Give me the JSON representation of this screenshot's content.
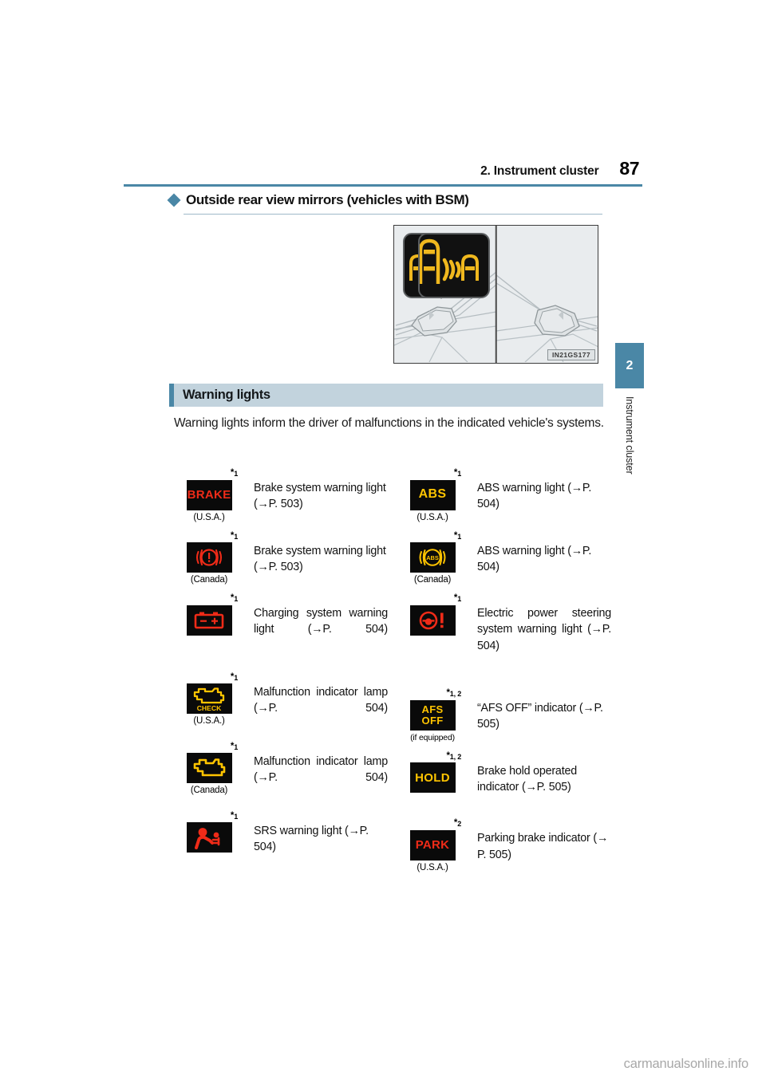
{
  "header": {
    "title": "2. Instrument cluster",
    "page_number": "87",
    "rule_color": "#4a87a6"
  },
  "sub_heading": {
    "bullet_icon": "diamond-bullet-icon",
    "text": "Outside rear view mirrors (vehicles with BSM)"
  },
  "figure": {
    "code": "IN21GS177",
    "alt": "Outside rear view mirrors with BSM indicator close-ups"
  },
  "section": {
    "title": "Warning lights",
    "accent_color": "#4a87a6",
    "band_color": "#c2d3dd",
    "intro": "Warning lights inform the driver of malfunctions in the indicated vehicle's systems."
  },
  "side_tab": {
    "number": "2",
    "label": "Instrument cluster",
    "color": "#4a87a6"
  },
  "watermark": "carmanualsonline.info",
  "colors": {
    "red": "#ef2b18",
    "amber": "#ffc400",
    "symbol_background": "#0a0a0a"
  },
  "warning_lights": {
    "left_column": [
      {
        "footnote": "*1",
        "symbol_type": "brake-text",
        "symbol_text": "BRAKE",
        "symbol_color": "#ef2b18",
        "note": "(U.S.A.)",
        "description": "Brake system warning light (→P. 503)"
      },
      {
        "footnote": "*1",
        "symbol_type": "brake-circle",
        "symbol_text": "(!)",
        "symbol_color": "#ef2b18",
        "note": "(Canada)",
        "description": "Brake system warning light (→P. 503)"
      },
      {
        "footnote": "*1",
        "symbol_type": "battery",
        "symbol_text": "",
        "symbol_color": "#ef2b18",
        "note": "",
        "description": "Charging system warning light (→P. 504)"
      },
      {
        "footnote": "*1",
        "symbol_type": "engine-check",
        "symbol_text": "CHECK",
        "symbol_color": "#ffc400",
        "note": "(U.S.A.)",
        "description": "Malfunction indicator lamp (→P. 504)"
      },
      {
        "footnote": "*1",
        "symbol_type": "engine",
        "symbol_text": "",
        "symbol_color": "#ffc400",
        "note": "(Canada)",
        "description": "Malfunction indicator lamp (→P. 504)"
      },
      {
        "footnote": "*1",
        "symbol_type": "srs-airbag",
        "symbol_text": "",
        "symbol_color": "#ef2b18",
        "note": "",
        "description": "SRS warning light (→P. 504)"
      }
    ],
    "right_column": [
      {
        "footnote": "*1",
        "symbol_type": "abs-text",
        "symbol_text": "ABS",
        "symbol_color": "#ffc400",
        "note": "(U.S.A.)",
        "description": "ABS warning light (→P. 504)"
      },
      {
        "footnote": "*1",
        "symbol_type": "abs-circle",
        "symbol_text": "ABS",
        "symbol_color": "#ffc400",
        "note": "(Canada)",
        "description": "ABS warning light (→P. 504)"
      },
      {
        "footnote": "*1",
        "symbol_type": "steering",
        "symbol_text": "!",
        "symbol_color": "#ef2b18",
        "note": "",
        "description": "Electric power steering system warning light (→P. 504)"
      },
      {
        "footnote": "*1, 2",
        "symbol_type": "afs-off",
        "symbol_text": "AFS OFF",
        "symbol_color": "#ffc400",
        "note": "(if equipped)",
        "description": "“AFS OFF” indicator (→P. 505)"
      },
      {
        "footnote": "*1, 2",
        "symbol_type": "hold-text",
        "symbol_text": "HOLD",
        "symbol_color": "#ffc400",
        "note": "",
        "description": "Brake hold operated indicator (→P. 505)"
      },
      {
        "footnote": "*2",
        "symbol_type": "park-text",
        "symbol_text": "PARK",
        "symbol_color": "#ef2b18",
        "note": "(U.S.A.)",
        "description": "Parking brake indicator (→ P. 505)"
      }
    ]
  }
}
